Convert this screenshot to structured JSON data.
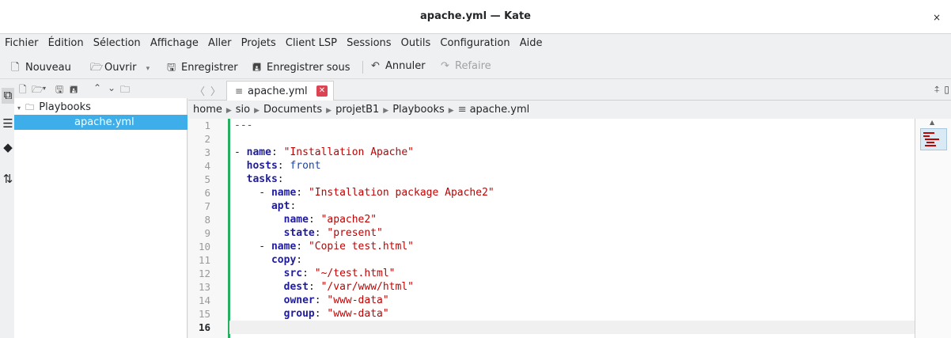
{
  "window": {
    "title": "apache.yml — Kate",
    "close_glyph": "×"
  },
  "menu": [
    "Fichier",
    "Édition",
    "Sélection",
    "Affichage",
    "Aller",
    "Projets",
    "Client LSP",
    "Sessions",
    "Outils",
    "Configuration",
    "Aide"
  ],
  "toolbar": {
    "new_label": "Nouveau",
    "open_label": "Ouvrir",
    "save_label": "Enregistrer",
    "save_as_label": "Enregistrer sous",
    "undo_label": "Annuler",
    "redo_label": "Refaire"
  },
  "file_tree": {
    "folder": "Playbooks",
    "file": "apache.yml"
  },
  "tab": {
    "label": "apache.yml",
    "close_glyph": "✕"
  },
  "breadcrumb": [
    "home",
    "sio",
    "Documents",
    "projetB1",
    "Playbooks",
    "apache.yml"
  ],
  "editor": {
    "current_line": "16",
    "line_numbers": [
      "1",
      "2",
      "3",
      "4",
      "5",
      "6",
      "7",
      "8",
      "9",
      "10",
      "11",
      "12",
      "13",
      "14",
      "15",
      "16"
    ]
  },
  "colors": {
    "accent": "#3daee9",
    "tab_close": "#da4453",
    "modified_marker": "#27ae60",
    "string": "#bf0303",
    "key": "#1f1c9f"
  }
}
